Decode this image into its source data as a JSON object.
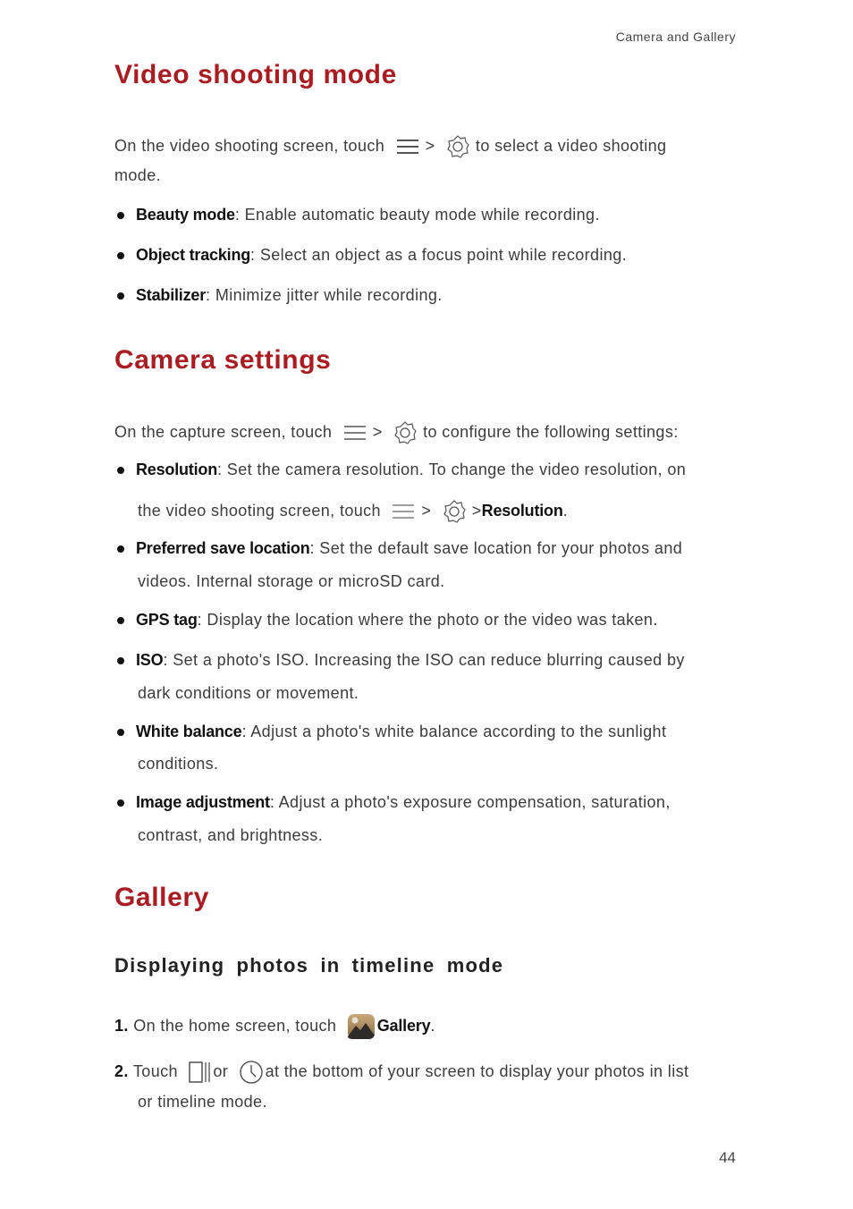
{
  "header": {
    "section": "Camera and Gallery",
    "page_number": "44"
  },
  "video_mode": {
    "title": "Video shooting mode",
    "intro_a": "On the video shooting screen, touch",
    "sep": ">",
    "intro_b": "to select a video shooting",
    "intro_c": "mode.",
    "items": [
      {
        "term": "Beauty mode",
        "desc": ": Enable automatic beauty mode while recording."
      },
      {
        "term": "Object tracking",
        "desc": ": Select an object as a focus point while recording."
      },
      {
        "term": "Stabilizer",
        "desc": ": Minimize jitter while recording."
      }
    ]
  },
  "camera_settings": {
    "title": "Camera settings",
    "intro_a": "On the capture screen, touch",
    "sep": ">",
    "intro_b": "to configure the following settings:",
    "items": [
      {
        "term": "Resolution",
        "desc": ": Set the camera resolution. To change the video resolution, on",
        "line2a": "the video shooting screen, touch",
        "line2_term": "Resolution",
        "line2_end": "."
      },
      {
        "term": "Preferred save location",
        "desc": ": Set the default save location for your photos and",
        "line2": "videos. Internal storage or microSD card."
      },
      {
        "term": "GPS tag",
        "desc": ": Display the location where the photo or the video was taken."
      },
      {
        "term": "ISO",
        "desc": ": Set a photo's ISO. Increasing the ISO can reduce blurring caused by",
        "line2": "dark conditions or movement."
      },
      {
        "term": "White balance",
        "desc": ": Adjust a photo's white balance according to the sunlight",
        "line2": "conditions."
      },
      {
        "term": "Image adjustment",
        "desc": ": Adjust a photo's exposure compensation, saturation,",
        "line2": "contrast, and brightness."
      }
    ]
  },
  "gallery": {
    "title": "Gallery",
    "subtitle": "Displaying photos in timeline mode",
    "steps": [
      {
        "num": "1.",
        "text_a": "On the home screen, touch",
        "term": "Gallery",
        "end": "."
      },
      {
        "num": "2.",
        "text_a": "Touch",
        "or": "or",
        "text_b": "at the bottom of your screen to display your photos in list",
        "line2": "or timeline mode."
      }
    ]
  }
}
